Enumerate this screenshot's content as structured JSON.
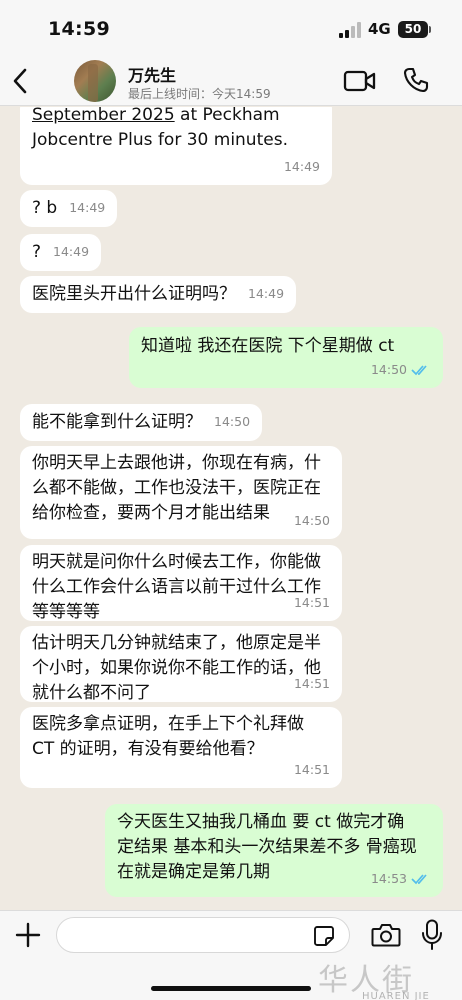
{
  "status_bar": {
    "time": "14:59",
    "network": "4G",
    "battery": "50"
  },
  "header": {
    "contact_name": "万先生",
    "last_seen": "最后上线时间：今天14:59"
  },
  "messages": [
    {
      "dir": "in",
      "text_line1": "September 2025",
      "text_rest": " at Peckham Jobcentre Plus for 30 minutes.",
      "time": "14:49"
    },
    {
      "dir": "in",
      "text": "? b",
      "time": "14:49"
    },
    {
      "dir": "in",
      "text": "?",
      "time": "14:49"
    },
    {
      "dir": "in",
      "text": "医院里头开出什么证明吗？",
      "time": "14:49"
    },
    {
      "dir": "out",
      "text": "知道啦 我还在医院 下个星期做 ct",
      "time": "14:50",
      "read": true
    },
    {
      "dir": "in",
      "text": "能不能拿到什么证明？",
      "time": "14:50"
    },
    {
      "dir": "in",
      "text": "你明天早上去跟他讲，你现在有病，什么都不能做，工作也没法干，医院正在给你检查，要两个月才能出结果",
      "time": "14:50"
    },
    {
      "dir": "in",
      "text": "明天就是问你什么时候去工作，你能做什么工作会什么语言以前干过什么工作等等等等",
      "time": "14:51"
    },
    {
      "dir": "in",
      "text": "估计明天几分钟就结束了，他原定是半个小时，如果你说你不能工作的话，他就什么都不问了",
      "time": "14:51"
    },
    {
      "dir": "in",
      "text": "医院多拿点证明，在手上下个礼拜做 CT 的证明，有没有要给他看？",
      "time": "14:51"
    },
    {
      "dir": "out",
      "text": "今天医生又抽我几桶血 要 ct 做完才确定结果  基本和头一次结果差不多 骨癌现在就是确定是第几期",
      "time": "14:53",
      "read": true
    }
  ],
  "input": {
    "placeholder": ""
  },
  "watermark": {
    "text": "华人街",
    "sub": "HUAREN JIE"
  },
  "colors": {
    "incoming": "#ffffff",
    "outgoing": "#d9fdd3",
    "background": "#efeae2",
    "read_tick": "#53bdeb"
  }
}
